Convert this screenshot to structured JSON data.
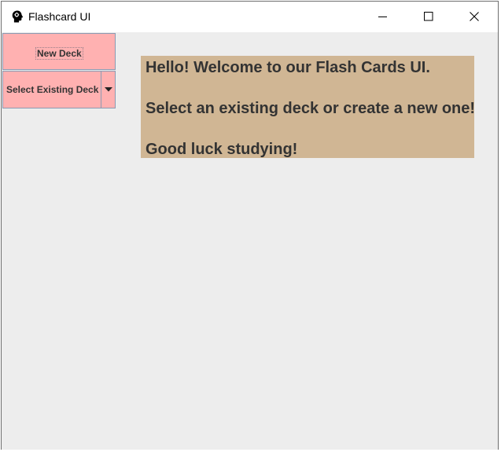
{
  "window": {
    "title": "Flashcard UI",
    "icon": "head-profile-icon",
    "controls": [
      "minimize-icon",
      "maximize-icon",
      "close-icon"
    ]
  },
  "sidebar": {
    "new_deck_label": "New Deck",
    "deck_select": {
      "selected": "Select Existing Deck",
      "arrow_icon": "caret-down-icon"
    }
  },
  "welcome": {
    "line1": "Hello! Welcome to our Flash Cards UI.",
    "line2": "Select an existing deck or create a new one!",
    "line3": "Good luck studying!"
  },
  "colors": {
    "button_bg": "#ffb1b1",
    "welcome_bg": "#d0b694",
    "content_bg": "#ededed",
    "text": "#333333"
  }
}
